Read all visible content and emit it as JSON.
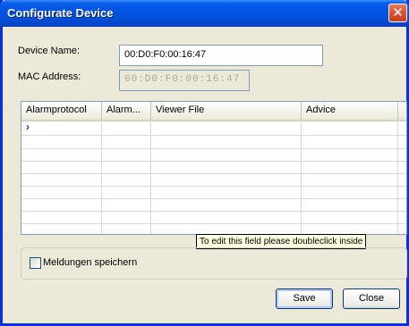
{
  "window": {
    "title": "Configurate Device",
    "close_glyph": "✕"
  },
  "form": {
    "device_name_label": "Device Name:",
    "device_name_value": "00:D0:F0:00:16:47",
    "mac_address_label": "MAC Address:",
    "mac_address_value": "00:D0:F0:00:16:47"
  },
  "grid": {
    "columns": [
      "Alarmprotocol",
      "Alarm...",
      "Viewer File",
      "Advice"
    ],
    "current_row_marker": "›",
    "tooltip": "To edit this field please doubleclick inside"
  },
  "options": {
    "save_messages_label": "Meldungen speichern",
    "save_messages_checked": false
  },
  "buttons": {
    "save_label": "Save",
    "close_label": "Close"
  },
  "colors": {
    "titlebar": "#0054e3",
    "dialog_background": "#ece9d8",
    "tooltip_background": "#ffffe1"
  }
}
